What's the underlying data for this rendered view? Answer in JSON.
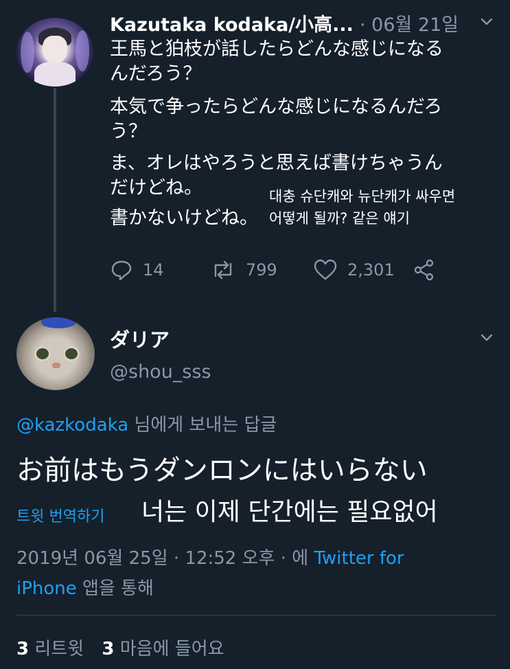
{
  "tweet1": {
    "display_name": "Kazutaka kodaka/小高...",
    "date": "· 06월 21일",
    "lines": [
      "王馬と狛枝が話したらどんな感じになる",
      "んだろう？",
      "本気で争ったらどんな感じになるんだろ",
      "う？",
      "ま、オレはやろうと思えば書けちゃうん",
      "だけどね。",
      "書かないけどね。"
    ],
    "annotation_lines": [
      "대충 슈단캐와 뉴단캐가 싸우면",
      "어떻게 될까? 같은 얘기"
    ],
    "replies": "14",
    "retweets": "799",
    "likes": "2,301"
  },
  "tweet2": {
    "display_name": "ダリア",
    "handle": "@shou_sss",
    "reply_handle": "@kazkodaka",
    "reply_suffix": " 님에게 보내는 답글",
    "text": "お前はもうダンロンにはいらない",
    "translate_label": "트윗 번역하기",
    "annotation": "너는 이제 단간에는 필요없어",
    "timestamp": "2019년 06월 25일 · 12:52 오후 · 에 ",
    "source_part1": "Twitter for",
    "source_part2": "iPhone",
    "source_suffix": " 앱을 통해",
    "retweet_count": "3",
    "retweet_label": " 리트윗",
    "like_count": "3",
    "like_label": " 마음에 들어요"
  },
  "colors": {
    "background": "#15202b",
    "muted": "#8899a6",
    "accent": "#1da1f2",
    "divider": "#38444d"
  },
  "icons": [
    "reply-icon",
    "retweet-icon",
    "like-icon",
    "share-icon",
    "chevron-down-icon"
  ]
}
